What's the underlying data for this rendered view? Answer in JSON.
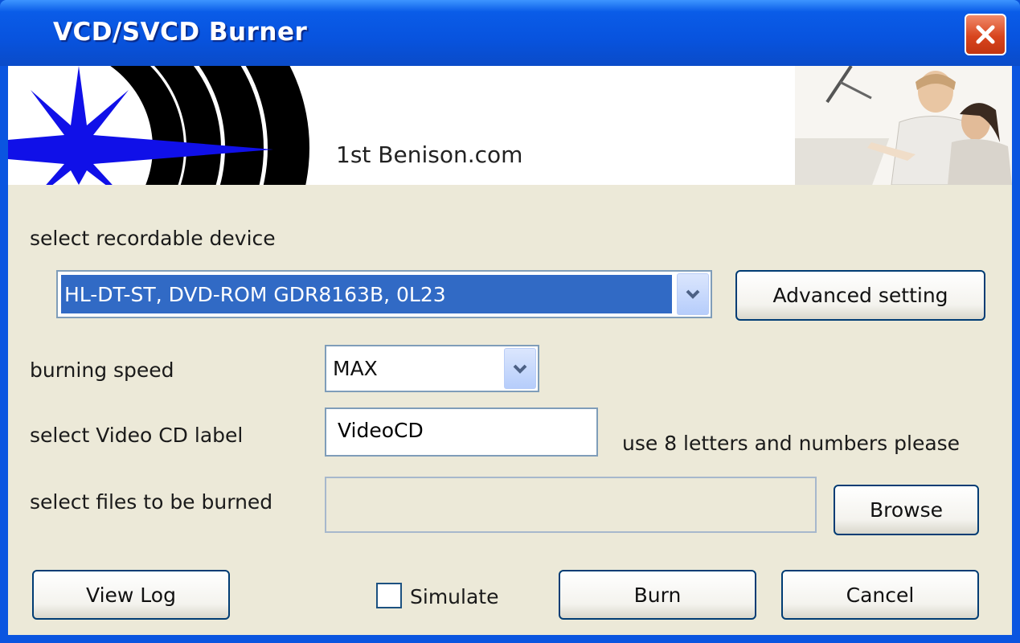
{
  "window": {
    "title": "VCD/SVCD Burner"
  },
  "banner": {
    "brand": "1st Benison.com"
  },
  "device": {
    "label": "select recordable device",
    "selected": "HL-DT-ST, DVD-ROM GDR8163B, 0L23",
    "advanced_button": "Advanced setting"
  },
  "speed": {
    "label": "burning speed",
    "selected": "MAX"
  },
  "cd_label": {
    "label": "select Video CD label",
    "value": "VideoCD",
    "hint": "use 8 letters and numbers please"
  },
  "files": {
    "label": "select files to be burned",
    "value": "",
    "browse_button": "Browse"
  },
  "footer": {
    "view_log_button": "View Log",
    "simulate_label": "Simulate",
    "simulate_checked": false,
    "burn_button": "Burn",
    "cancel_button": "Cancel"
  },
  "colors": {
    "titlebar": "#0a55e0",
    "close": "#d8451e",
    "dialog_bg": "#ece9d8",
    "selection": "#316ac5",
    "star": "#1010e8"
  },
  "icons": {
    "close": "close-icon",
    "dropdown": "chevron-down-icon",
    "logo": "star-logo-icon"
  }
}
